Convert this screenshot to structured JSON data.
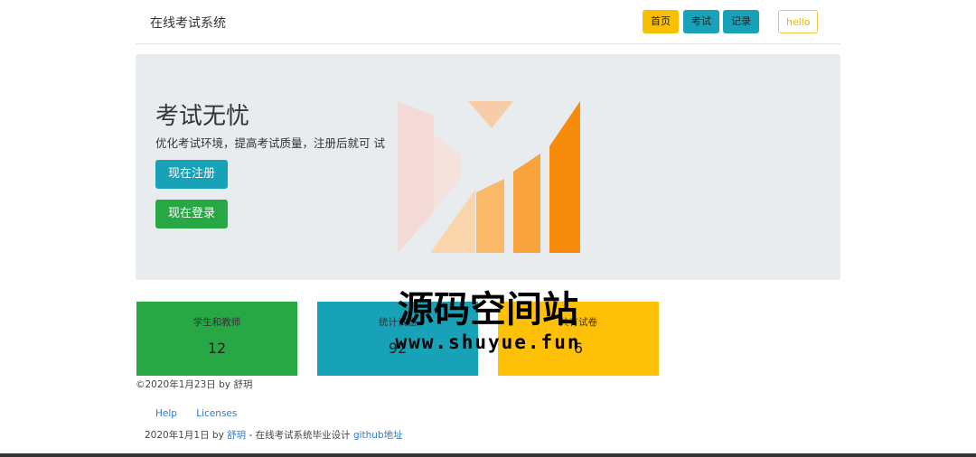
{
  "navbar": {
    "brand": "在线考试系统",
    "items": [
      {
        "label": "首页"
      },
      {
        "label": "考试"
      },
      {
        "label": "记录"
      }
    ],
    "user": "hello"
  },
  "jumbotron": {
    "title": "考试无忧",
    "lead": "优化考试环境，提高考试质量，注册后就可   试",
    "register_label": "现在注册",
    "login_label": "现在登录"
  },
  "stats": [
    {
      "label": "学生和教师",
      "value": "12",
      "color": "#28a745"
    },
    {
      "label": "统计试题",
      "value": "92",
      "color": "#17a2b8"
    },
    {
      "label": "共有试卷",
      "value": "6",
      "color": "#ffc107"
    }
  ],
  "copyright": "©2020年1月23日 by 舒玥",
  "footer": {
    "links": [
      "Help",
      "Licenses"
    ],
    "note_prefix": "2020年1月1日 by ",
    "author": "舒玥",
    "note_middle": " - 在线考试系统毕业设计 ",
    "github_label": "github地址"
  },
  "watermark": {
    "title": "源码空间站",
    "url": "www.shuyue.fun"
  },
  "colors": {
    "primary": "#17a2b8",
    "success": "#28a745",
    "warning": "#ffc107",
    "logo_orange": "#f7900f"
  }
}
